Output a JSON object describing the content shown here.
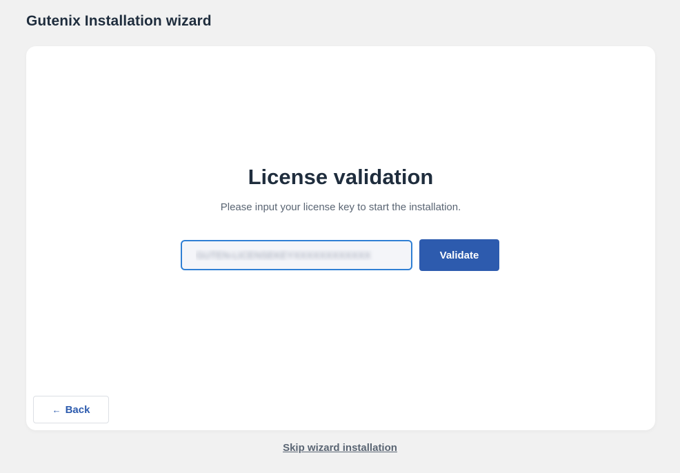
{
  "header": {
    "title": "Gutenix Installation wizard"
  },
  "main": {
    "heading": "License validation",
    "subtext": "Please input your license key to start the installation.",
    "license_input_value": "GUTEN-LICENSEKEYXXXXXXXXXXXX",
    "validate_label": "Validate"
  },
  "footer": {
    "back_icon": "←",
    "back_label": "Back",
    "skip_label": "Skip wizard installation"
  },
  "colors": {
    "background": "#f1f1f1",
    "card": "#ffffff",
    "primary": "#2d5bae",
    "input_border": "#2f7fd4",
    "text_dark": "#1f2d3d",
    "text_muted": "#5a6573"
  }
}
